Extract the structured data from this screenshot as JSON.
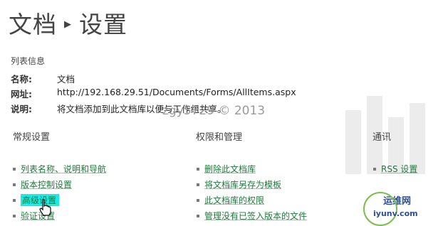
{
  "page": {
    "breadcrumb_parent": "文档",
    "breadcrumb_current": "设置"
  },
  "list_info": {
    "heading": "列表信息",
    "rows": [
      {
        "key": "名称:",
        "value": "文档"
      },
      {
        "key": "网址:",
        "value": "http://192.168.29.51/Documents/Forms/AllItems.aspx"
      },
      {
        "key": "说明:",
        "value": "将文档添加到此文档库以便与工作组共享。"
      }
    ]
  },
  "watermark": "zgy5729 © 2013",
  "columns": {
    "general": {
      "heading": "常规设置",
      "links": [
        "列表名称、说明和导航",
        "版本控制设置",
        "高级设置",
        "验证设置"
      ]
    },
    "permissions": {
      "heading": "权限和管理",
      "links": [
        "删除此文档库",
        "将文档库另存为模板",
        "此文档库的权限",
        "管理没有已签入版本的文件"
      ]
    },
    "communications": {
      "heading": "通讯",
      "links": [
        "RSS 设置"
      ]
    }
  },
  "logo": {
    "cn": "运维网",
    "en": "iyunv.com"
  },
  "colors": {
    "link": "#1e7a3a",
    "highlight": "#18e9e9"
  }
}
